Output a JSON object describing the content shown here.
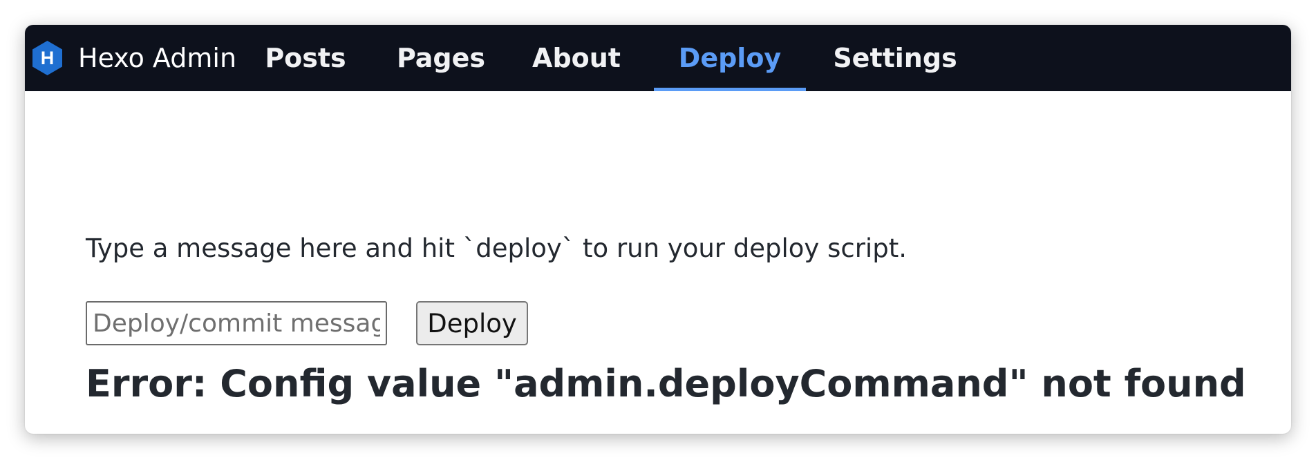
{
  "app": {
    "title": "Hexo Admin",
    "logo_letter": "H",
    "logo_color": "#1f6fd1"
  },
  "nav": {
    "items": [
      {
        "label": "Posts",
        "active": false
      },
      {
        "label": "Pages",
        "active": false
      },
      {
        "label": "About",
        "active": false
      },
      {
        "label": "Deploy",
        "active": true
      },
      {
        "label": "Settings",
        "active": false
      }
    ],
    "background_color": "#0d111c",
    "active_color": "#5b9cf6"
  },
  "deploy": {
    "instructions": "Type a message here and hit `deploy` to run your deploy script.",
    "message_input": {
      "value": "",
      "placeholder": "Deploy/commit message"
    },
    "button_label": "Deploy",
    "error": "Error: Config value \"admin.deployCommand\" not found"
  }
}
